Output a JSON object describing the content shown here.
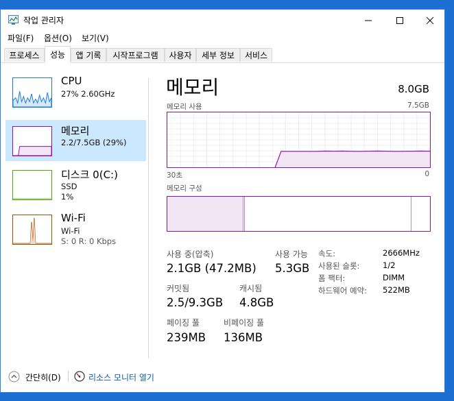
{
  "window": {
    "title": "작업 관리자"
  },
  "menu": [
    "파일(F)",
    "옵션(O)",
    "보기(V)"
  ],
  "tabs": [
    "프로세스",
    "성능",
    "앱 기록",
    "시작프로그램",
    "사용자",
    "세부 정보",
    "서비스"
  ],
  "active_tab": "성능",
  "sidebar": [
    {
      "name": "CPU",
      "sub1": "27% 2.60GHz",
      "sub2": "",
      "color": "#1b7ad6",
      "selected": false
    },
    {
      "name": "메모리",
      "sub1": "2.2/7.5GB (29%)",
      "sub2": "",
      "color": "#8b12ae",
      "selected": true
    },
    {
      "name": "디스크 0(C:)",
      "sub1": "SSD",
      "sub2": "1%",
      "color": "#4da60c",
      "selected": false
    },
    {
      "name": "Wi-Fi",
      "sub1": "Wi-Fi",
      "sub2": "S: 0 R: 0 Kbps",
      "color": "#a74f01",
      "selected": false
    }
  ],
  "main": {
    "title": "메모리",
    "total": "8.0GB",
    "usage_label": "메모리 사용",
    "usage_max": "7.5GB",
    "time_label": "30초",
    "time_end": "0",
    "composition_label": "메모리 구성"
  },
  "stats": {
    "in_use_label": "사용 중(압축)",
    "in_use_value": "2.1GB (47.2MB)",
    "available_label": "사용 가능",
    "available_value": "5.3GB",
    "committed_label": "커밋됨",
    "committed_value": "2.5/9.3GB",
    "cached_label": "캐시됨",
    "cached_value": "4.8GB",
    "paged_label": "페이징 풀",
    "paged_value": "239MB",
    "nonpaged_label": "비페이징 풀",
    "nonpaged_value": "136MB"
  },
  "properties": [
    {
      "label": "속도:",
      "value": "2666MHz"
    },
    {
      "label": "사용된 슬롯:",
      "value": "1/2"
    },
    {
      "label": "폼 팩터:",
      "value": "DIMM"
    },
    {
      "label": "하드웨어 예약:",
      "value": "522MB"
    }
  ],
  "footer": {
    "collapse_label": "간단히(D)",
    "monitor_label": "리소스 모니터 열기"
  },
  "memory_usage_series": [
    0,
    0,
    0,
    0,
    0,
    0,
    0,
    0,
    0,
    0,
    0,
    0,
    0,
    29,
    29,
    29,
    29,
    29,
    29.5,
    29.3,
    29.5,
    29.2,
    29,
    29.3,
    29.5,
    29.3,
    29,
    29.2,
    29.3,
    29.5,
    29.3
  ]
}
